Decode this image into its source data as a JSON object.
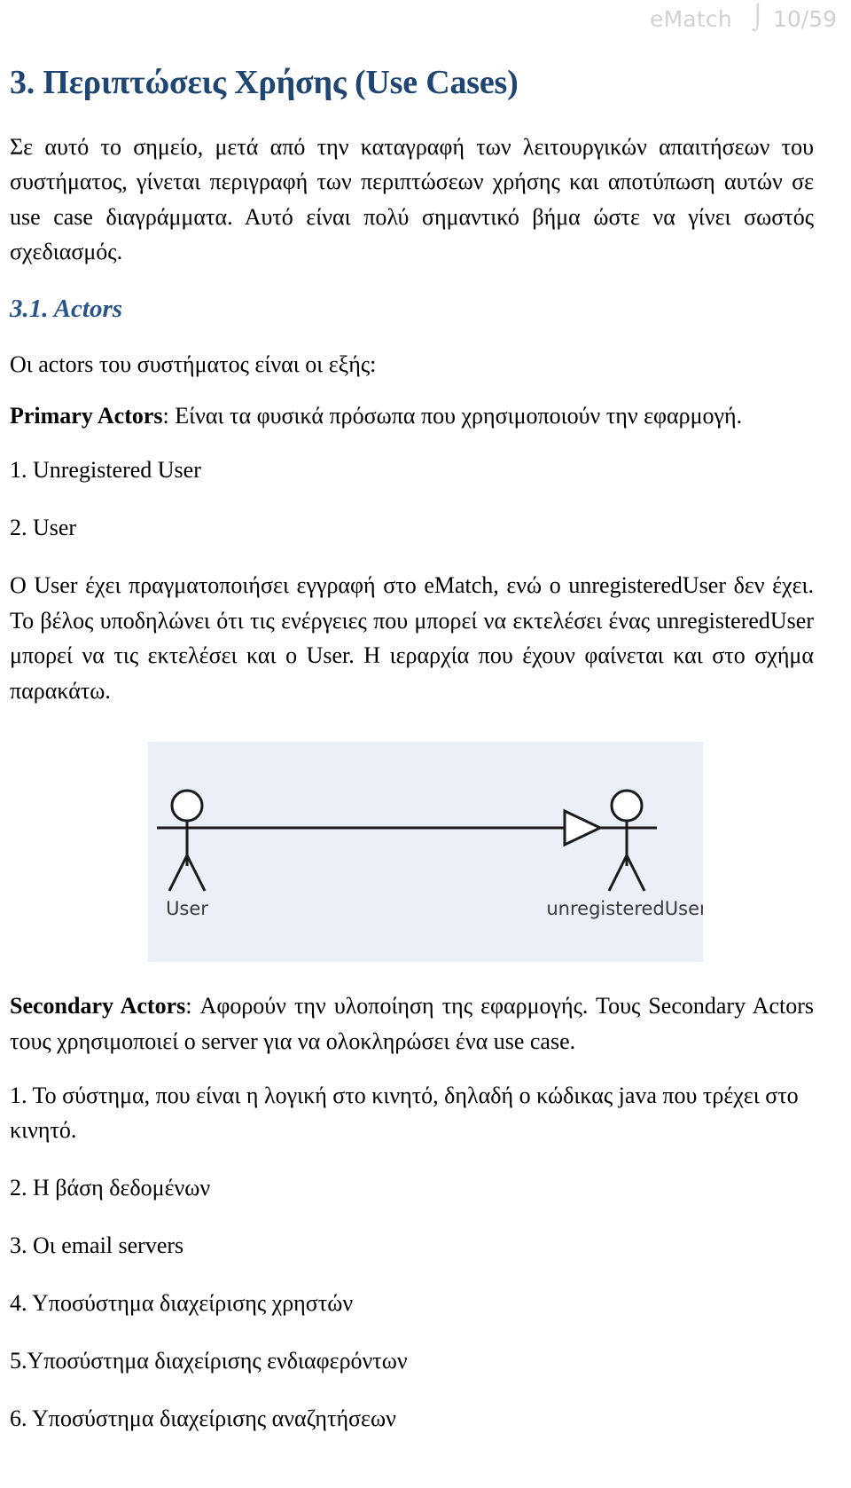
{
  "header": {
    "doc_title": "eMatch",
    "separator": "⌡",
    "page_indicator": "10/59"
  },
  "section": {
    "heading": "3. Περιπτώσεις Χρήσης (Use Cases)",
    "intro_paragraph": "Σε αυτό το σημείο, μετά από την καταγραφή των λειτουργικών απαιτήσεων του συστήματος, γίνεται περιγραφή των περιπτώσεων χρήσης και αποτύπωση αυτών σε use case διαγράμματα. Αυτό είναι πολύ σημαντικό βήμα ώστε να γίνει σωστός σχεδιασμός."
  },
  "subsection": {
    "heading": "3.1. Actors",
    "lead_in": "Οι actors του συστήματος είναι οι εξής:",
    "primary": {
      "label": "Primary Actors",
      "description": ": Είναι τα φυσικά πρόσωπα που χρησιμοποιούν την εφαρμογή.",
      "items": [
        "1. Unregistered User",
        "2. User"
      ],
      "explanation": "Ο User έχει πραγματοποιήσει εγγραφή στο eMatch, ενώ ο unregisteredUser δεν έχει. Το βέλος υποδηλώνει ότι τις ενέργειες που μπορεί να εκτελέσει ένας unregisteredUser μπορεί να τις εκτελέσει και ο User. Η ιεραρχία που έχουν φαίνεται και στο σχήμα παρακάτω."
    },
    "secondary": {
      "label": "Secondary Actors",
      "description": ": Αφορούν την υλοποίηση της εφαρμογής. Τους Secondary Actors τους χρησιμοποιεί ο server για να ολοκληρώσει ένα use case.",
      "items": [
        "1. Το σύστημα, που είναι η λογική στο κινητό, δηλαδή ο κώδικας java που τρέχει στο κινητό.",
        "2. Η βάση δεδομένων",
        "3. Οι email servers",
        "4. Υποσύστημα διαχείρισης χρηστών",
        "5.Υποσύστημα διαχείρισης ενδιαφερόντων",
        "6. Υποσύστημα διαχείρισης αναζητήσεων"
      ]
    }
  },
  "diagram": {
    "type": "uml-use-case-actor-generalization",
    "background_color": "#eaeff8",
    "actor_left_label": "User",
    "actor_right_label": "unregisteredUser",
    "relationship": "generalization-arrow-pointing-right"
  }
}
